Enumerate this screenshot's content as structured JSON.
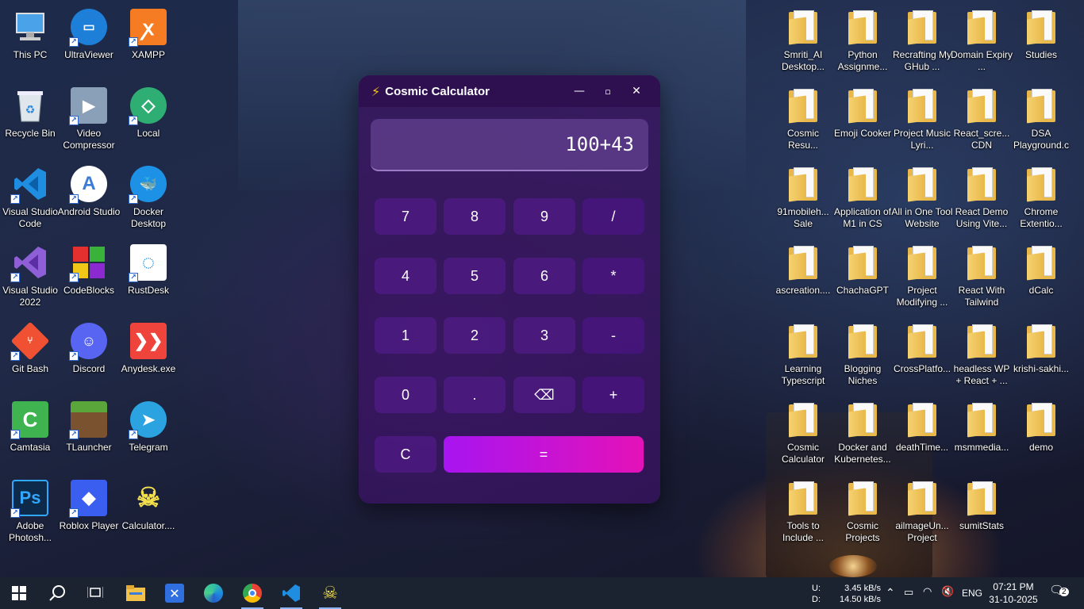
{
  "desktop_left": [
    {
      "label": "This PC",
      "icon": "this-pc-icon"
    },
    {
      "label": "UltraViewer",
      "icon": "ultraviewer-icon"
    },
    {
      "label": "XAMPP",
      "icon": "xampp-icon"
    },
    {
      "label": "Recycle Bin",
      "icon": "recycle-bin-icon"
    },
    {
      "label": "Video Compressor",
      "icon": "video-compressor-icon"
    },
    {
      "label": "Local",
      "icon": "local-icon"
    },
    {
      "label": "Visual Studio Code",
      "icon": "vscode-icon"
    },
    {
      "label": "Android Studio",
      "icon": "android-studio-icon"
    },
    {
      "label": "Docker Desktop",
      "icon": "docker-icon"
    },
    {
      "label": "Visual Studio 2022",
      "icon": "visual-studio-icon"
    },
    {
      "label": "CodeBlocks",
      "icon": "codeblocks-icon"
    },
    {
      "label": "RustDesk",
      "icon": "rustdesk-icon"
    },
    {
      "label": "Git Bash",
      "icon": "git-bash-icon"
    },
    {
      "label": "Discord",
      "icon": "discord-icon"
    },
    {
      "label": "Anydesk.exe",
      "icon": "anydesk-icon"
    },
    {
      "label": "Camtasia",
      "icon": "camtasia-icon"
    },
    {
      "label": "TLauncher",
      "icon": "tlauncher-icon"
    },
    {
      "label": "Telegram",
      "icon": "telegram-icon"
    },
    {
      "label": "Adobe Photosh...",
      "icon": "photoshop-icon"
    },
    {
      "label": "Roblox Player",
      "icon": "roblox-icon"
    },
    {
      "label": "Calculator....",
      "icon": "calculator-skull-icon"
    }
  ],
  "desktop_right": [
    {
      "label": "Smriti_AI Desktop..."
    },
    {
      "label": "Python Assignme..."
    },
    {
      "label": "Recrafting My GHub ..."
    },
    {
      "label": "Domain Expiry ..."
    },
    {
      "label": "Studies"
    },
    {
      "label": "Cosmic Resu..."
    },
    {
      "label": "Emoji Cooker"
    },
    {
      "label": "Project Music Lyri..."
    },
    {
      "label": "React_scre... CDN"
    },
    {
      "label": "DSA Playground.c"
    },
    {
      "label": "91mobileh... Sale"
    },
    {
      "label": "Application of M1 in CS"
    },
    {
      "label": "All in One Tool Website"
    },
    {
      "label": "React Demo Using Vite..."
    },
    {
      "label": "Chrome Extentio..."
    },
    {
      "label": "ascreation...."
    },
    {
      "label": "ChachaGPT"
    },
    {
      "label": "Project Modifying ..."
    },
    {
      "label": "React With Tailwind"
    },
    {
      "label": "dCalc"
    },
    {
      "label": "Learning Typescript"
    },
    {
      "label": "Blogging Niches"
    },
    {
      "label": "CrossPlatfo..."
    },
    {
      "label": "headless WP + React + ..."
    },
    {
      "label": "krishi-sakhi..."
    },
    {
      "label": "Cosmic Calculator"
    },
    {
      "label": "Docker and Kubernetes..."
    },
    {
      "label": "deathTime..."
    },
    {
      "label": "msmmedia..."
    },
    {
      "label": "demo"
    },
    {
      "label": "Tools to Include ..."
    },
    {
      "label": "Cosmic Projects"
    },
    {
      "label": "ailmageUn... Project"
    },
    {
      "label": "sumitStats"
    }
  ],
  "calculator": {
    "title": "Cosmic Calculator",
    "title_icon": "⚡",
    "minimize": "—",
    "maximize": "▫",
    "close": "✕",
    "display": "100+43",
    "keys": {
      "k7": "7",
      "k8": "8",
      "k9": "9",
      "div": "/",
      "k4": "4",
      "k5": "5",
      "k6": "6",
      "mul": "*",
      "k1": "1",
      "k2": "2",
      "k3": "3",
      "sub": "-",
      "k0": "0",
      "dot": ".",
      "back": "⌫",
      "add": "+",
      "clear": "C",
      "equals": "="
    }
  },
  "taskbar": {
    "net_labels": [
      "U:",
      "D:"
    ],
    "upload": "3.45 kB/s",
    "download": "14.50 kB/s",
    "lang": "ENG",
    "time": "07:21 PM",
    "date": "31-10-2025",
    "notifications": "2"
  }
}
